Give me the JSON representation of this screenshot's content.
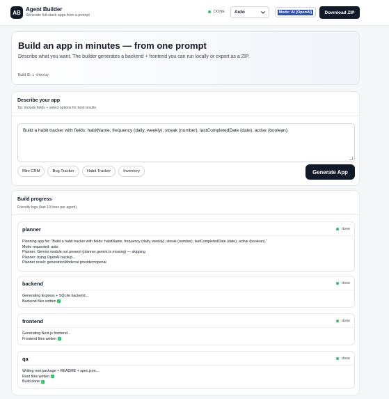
{
  "header": {
    "logo_text": "AB",
    "title": "Agent Builder",
    "subtitle": "Generate full-stack apps from a prompt",
    "status": "DONE",
    "mode_select": "Auto",
    "mode_badge": "Mode: AI (OpenAI)",
    "download_label": "Download ZIP"
  },
  "hero": {
    "title": "Build an app in minutes — from one prompt",
    "description": "Describe what you want. The builder generates a backend + frontend you can run locally or export as a ZIP.",
    "build_label": "Build ID:",
    "build_id": "1-dtmxuy"
  },
  "describe": {
    "title": "Describe your app",
    "tip": "Tip: include fields + select options for best results",
    "prompt_value": "Build a habit tracker with fields: habitName, frequency (daily, weekly), streak (number), lastCompletedDate (date), active (boolean).",
    "chips": [
      "Mini CRM",
      "Bug Tracker",
      "Habit Tracker",
      "Inventory"
    ],
    "generate_label": "Generate App"
  },
  "progress": {
    "title": "Build progress",
    "subtitle": "Friendly logs (last 10 lines per agent)",
    "agents": [
      {
        "name": "planner",
        "status": "done",
        "logs": [
          "Planning app for: \"Build a habit tracker with fields: habitName, frequency (daily, weekly), streak (number), lastCompletedDate (date), active (boolean).\"",
          "Mode requested: auto",
          "Planner: Gemini module not present (planner.gemini.ts missing) — skipping",
          "Planner: trying OpenAI backup...",
          "Planner result: generationMode=ai provider=openai"
        ]
      },
      {
        "name": "backend",
        "status": "done",
        "logs": [
          "Generating Express + SQLite backend...",
          "Backend files written"
        ]
      },
      {
        "name": "frontend",
        "status": "done",
        "logs": [
          "Generating Next.js frontend...",
          "Frontend files written"
        ]
      },
      {
        "name": "qa",
        "status": "done",
        "logs": [
          "Writing root package + README + spec.json...",
          "Root files written",
          "Build done"
        ]
      }
    ]
  }
}
